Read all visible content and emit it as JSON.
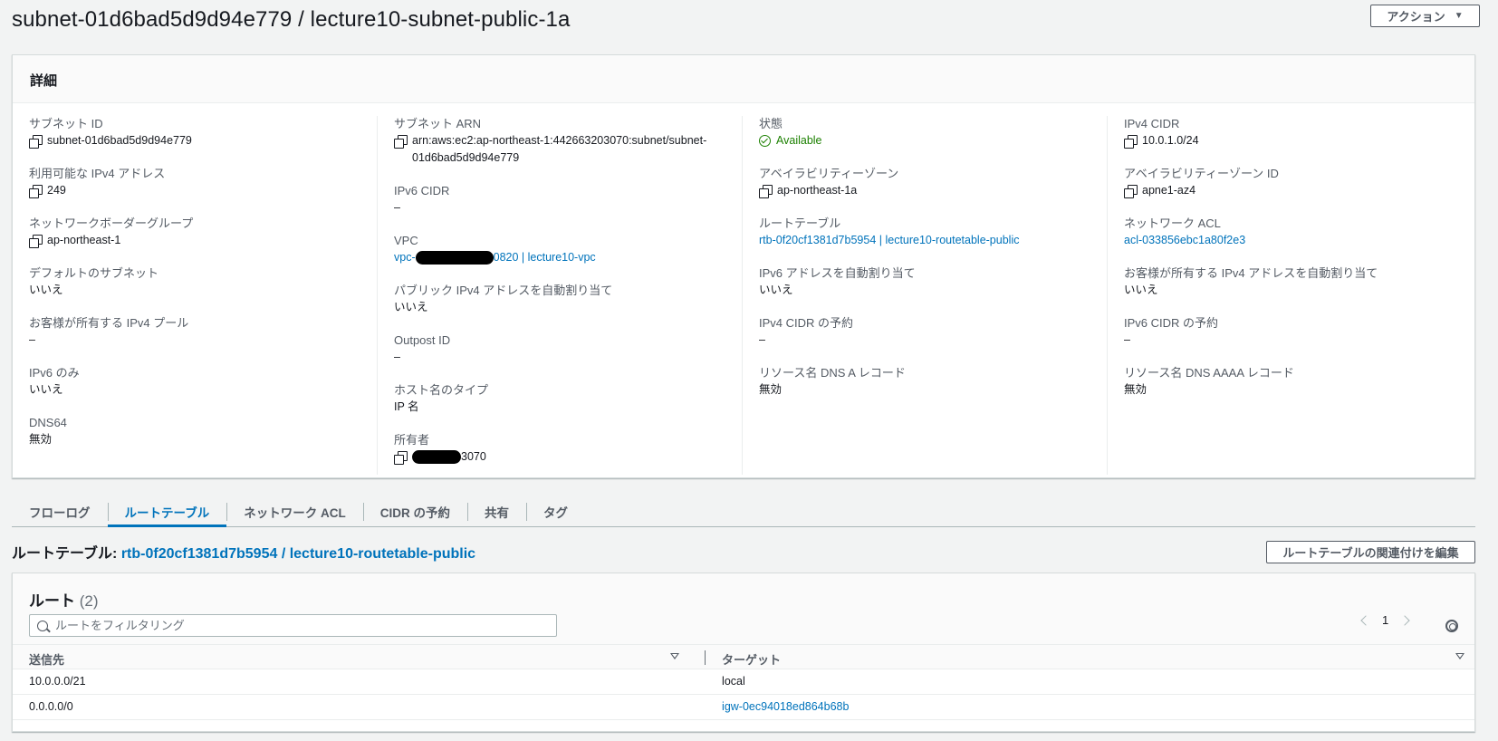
{
  "page": {
    "title": "subnet-01d6bad5d9d94e779 / lecture10-subnet-public-1a",
    "action_button": "アクション"
  },
  "details": {
    "header": "詳細",
    "col1": {
      "subnet_id_label": "サブネット ID",
      "subnet_id_value": "subnet-01d6bad5d9d94e779",
      "ipv4_avail_label": "利用可能な IPv4 アドレス",
      "ipv4_avail_value": "249",
      "nbg_label": "ネットワークボーダーグループ",
      "nbg_value": "ap-northeast-1",
      "default_subnet_label": "デフォルトのサブネット",
      "default_subnet_value": "いいえ",
      "customer_pool_label": "お客様が所有する IPv4 プール",
      "customer_pool_value": "–",
      "ipv6_only_label": "IPv6 のみ",
      "ipv6_only_value": "いいえ",
      "dns64_label": "DNS64",
      "dns64_value": "無効"
    },
    "col2": {
      "arn_label": "サブネット ARN",
      "arn_value_line1": "arn:aws:ec2:ap-northeast-1:442663203070:subnet/subnet-",
      "arn_value_line2": "01d6bad5d9d94e779",
      "ipv6_cidr_label": "IPv6 CIDR",
      "ipv6_cidr_value": "–",
      "vpc_label": "VPC",
      "vpc_prefix": "vpc-",
      "vpc_suffix": "0820 | lecture10-vpc",
      "auto_ipv4_label": "パブリック IPv4 アドレスを自動割り当て",
      "auto_ipv4_value": "いいえ",
      "outpost_label": "Outpost ID",
      "outpost_value": "–",
      "hostname_label": "ホスト名のタイプ",
      "hostname_value": "IP 名",
      "owner_label": "所有者",
      "owner_suffix": "3070"
    },
    "col3": {
      "state_label": "状態",
      "state_value": "Available",
      "az_label": "アベイラビリティーゾーン",
      "az_value": "ap-northeast-1a",
      "rt_label": "ルートテーブル",
      "rt_value": "rtb-0f20cf1381d7b5954 | lecture10-routetable-public",
      "auto_ipv6_label": "IPv6 アドレスを自動割り当て",
      "auto_ipv6_value": "いいえ",
      "ipv4_res_label": "IPv4 CIDR の予約",
      "ipv4_res_value": "–",
      "dns_a_label": "リソース名 DNS A レコード",
      "dns_a_value": "無効"
    },
    "col4": {
      "ipv4_cidr_label": "IPv4 CIDR",
      "ipv4_cidr_value": "10.0.1.0/24",
      "az_id_label": "アベイラビリティーゾーン ID",
      "az_id_value": "apne1-az4",
      "acl_label": "ネットワーク ACL",
      "acl_value": "acl-033856ebc1a80f2e3",
      "customer_ipv4_label": "お客様が所有する IPv4 アドレスを自動割り当て",
      "customer_ipv4_value": "いいえ",
      "ipv6_res_label": "IPv6 CIDR の予約",
      "ipv6_res_value": "–",
      "dns_aaaa_label": "リソース名 DNS AAAA レコード",
      "dns_aaaa_value": "無効"
    }
  },
  "tabs": [
    {
      "label": "フローログ",
      "active": false
    },
    {
      "label": "ルートテーブル",
      "active": true
    },
    {
      "label": "ネットワーク ACL",
      "active": false
    },
    {
      "label": "CIDR の予約",
      "active": false
    },
    {
      "label": "共有",
      "active": false
    },
    {
      "label": "タグ",
      "active": false
    }
  ],
  "route_table": {
    "title_prefix": "ルートテーブル: ",
    "title_link": "rtb-0f20cf1381d7b5954 / lecture10-routetable-public",
    "edit_button": "ルートテーブルの関連付けを編集",
    "routes_title": "ルート",
    "routes_count": "(2)",
    "filter_placeholder": "ルートをフィルタリング",
    "page_number": "1",
    "columns": [
      "送信先",
      "ターゲット"
    ],
    "rows": [
      {
        "destination": "10.0.0.0/21",
        "target": "local",
        "target_link": false
      },
      {
        "destination": "0.0.0.0/0",
        "target": "igw-0ec94018ed864b68b",
        "target_link": true
      }
    ]
  },
  "colors": {
    "link": "#0073bb",
    "status_ok": "#1d8102",
    "background": "#f2f3f3"
  }
}
